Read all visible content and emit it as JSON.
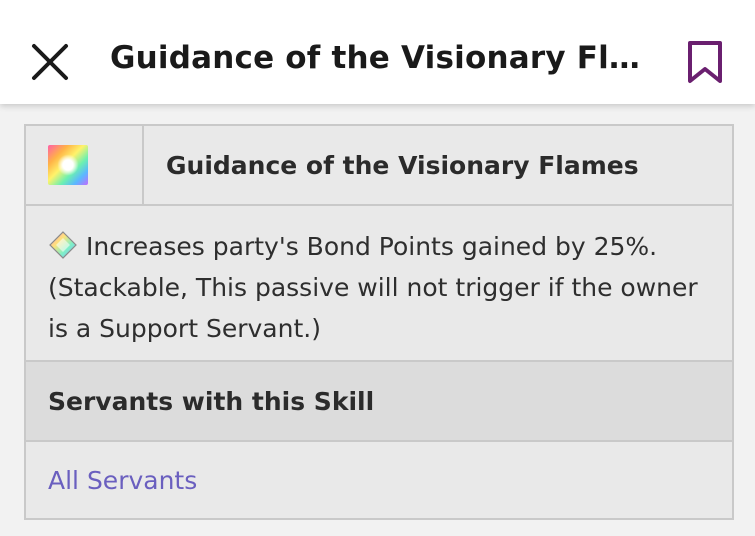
{
  "header": {
    "title": "Guidance of the Visionary Flame…",
    "close_icon": "close-icon",
    "bookmark_icon": "bookmark-icon",
    "bookmark_color": "#6a1f6f"
  },
  "skill": {
    "name": "Guidance of the Visionary Flames",
    "icon": "rainbow-skill-icon",
    "description": "Increases party's Bond Points gained by 25%. (Stackable, This passive will not trigger if the owner is a Support Servant.)",
    "description_icon": "gem-icon"
  },
  "servants_section": {
    "heading": "Servants with this Skill",
    "link_label": "All Servants",
    "link_color": "#6a5fbf"
  }
}
